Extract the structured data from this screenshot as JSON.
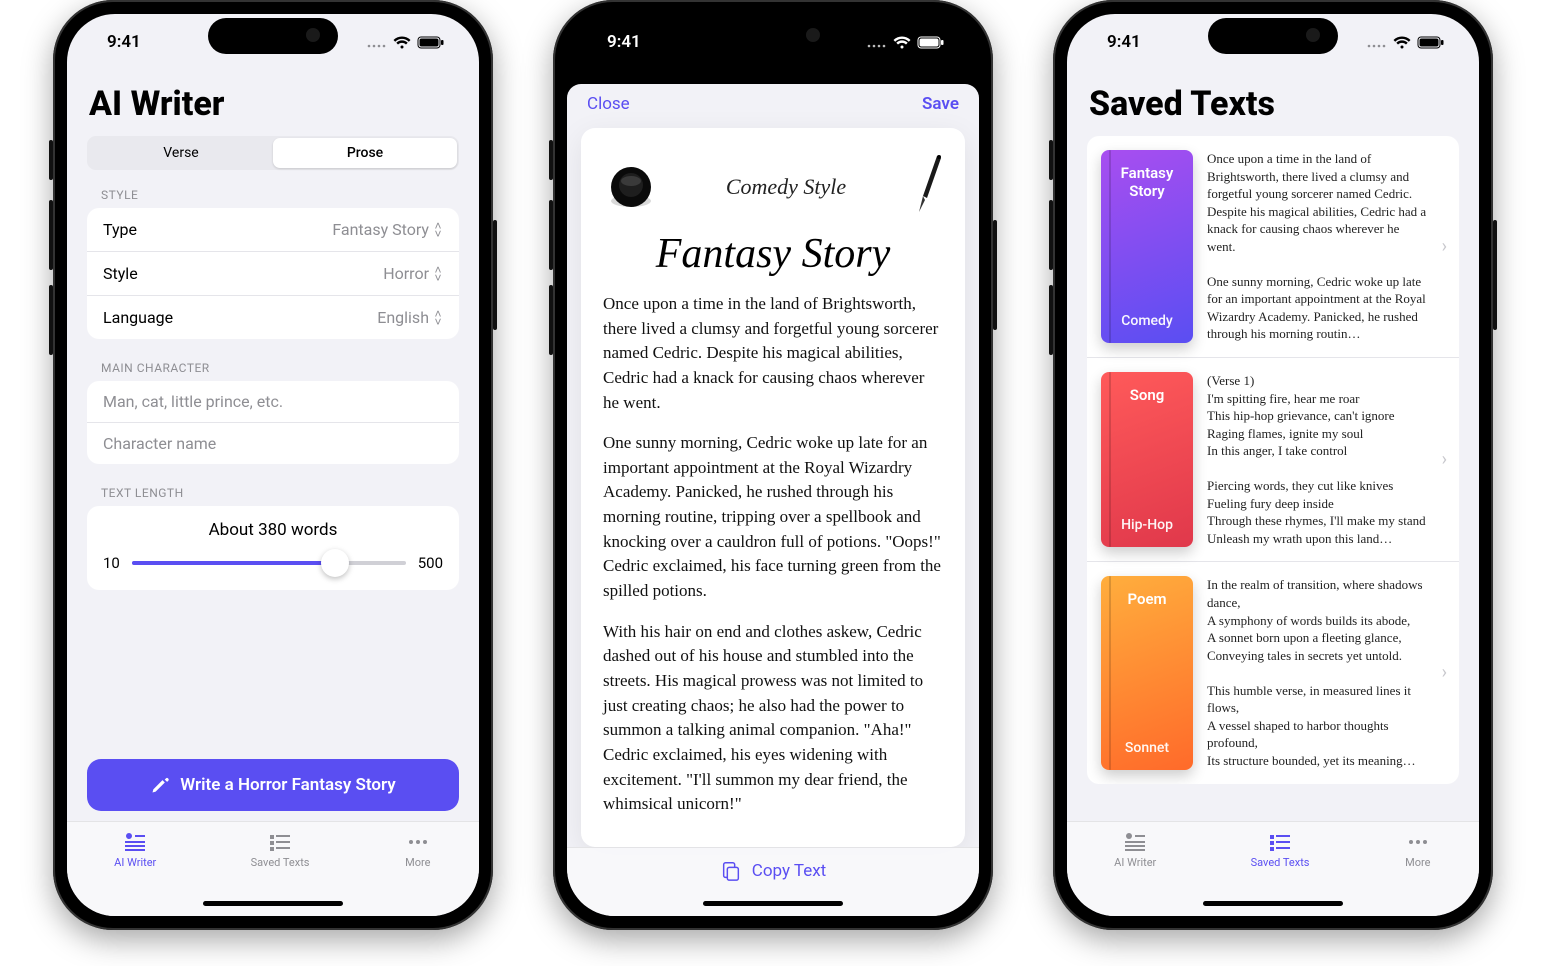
{
  "status": {
    "time": "9:41"
  },
  "phone1": {
    "title": "AI Writer",
    "segmented": {
      "options": [
        "Verse",
        "Prose"
      ],
      "active": 1
    },
    "style_section_label": "STYLE",
    "style_rows": [
      {
        "k": "Type",
        "v": "Fantasy Story"
      },
      {
        "k": "Style",
        "v": "Horror"
      },
      {
        "k": "Language",
        "v": "English"
      }
    ],
    "main_char_label": "MAIN CHARACTER",
    "main_char_placeholders": [
      "Man, cat, little prince, etc.",
      "Character name"
    ],
    "length_label": "TEXT LENGTH",
    "about_words": "About 380 words",
    "slider": {
      "min": "10",
      "max": "500",
      "pos_pct": 74
    },
    "cta": "Write a Horror Fantasy Story",
    "tabs": [
      "AI Writer",
      "Saved Texts",
      "More"
    ],
    "active_tab": 0
  },
  "phone2": {
    "close": "Close",
    "save": "Save",
    "style_label": "Comedy Style",
    "title": "Fantasy Story",
    "paragraphs": [
      "Once upon a time in the land of Brightsworth, there lived a clumsy and forgetful young sorcerer named Cedric. Despite his magical abilities, Cedric had a knack for causing chaos wherever he went.",
      "One sunny morning, Cedric woke up late for an important appointment at the Royal Wizardry Academy. Panicked, he rushed through his morning routine, tripping over a spellbook and knocking over a cauldron full of potions. \"Oops!\" Cedric exclaimed, his face turning green from the spilled potions.",
      "With his hair on end and clothes askew, Cedric dashed out of his house and stumbled into the streets. His magical prowess was not limited to just creating chaos; he also had the power to summon a talking animal companion. \"Aha!\" Cedric exclaimed, his eyes widening with excitement. \"I'll summon my dear friend, the whimsical unicorn!\""
    ],
    "copy": "Copy Text"
  },
  "phone3": {
    "title": "Saved Texts",
    "items": [
      {
        "tile_title": "Fantasy Story",
        "tile_sub": "Comedy",
        "grad": "grad-purple",
        "snippet": "Once upon a time in the land of Brightsworth, there lived a clumsy and forgetful young sorcerer named Cedric. Despite his magical abilities, Cedric had a knack for causing chaos wherever he went.\n\nOne sunny morning, Cedric woke up late for an important appointment at the Royal Wizardry Academy. Panicked, he rushed through his morning routin…"
      },
      {
        "tile_title": "Song",
        "tile_sub": "Hip-Hop",
        "grad": "grad-red",
        "snippet": "(Verse 1)\nI'm spitting fire, hear me roar\nThis hip-hop grievance, can't ignore\nRaging flames, ignite my soul\nIn this anger, I take control\n\nPiercing words, they cut like knives\nFueling fury deep inside\nThrough these rhymes, I'll make my stand\nUnleash my wrath upon this land…"
      },
      {
        "tile_title": "Poem",
        "tile_sub": "Sonnet",
        "grad": "grad-orange",
        "snippet": "In the realm of transition, where shadows dance,\nA symphony of words builds its abode,\nA sonnet born upon a fleeting glance,\nConveying tales in secrets yet untold.\n\nThis humble verse, in measured lines it flows,\nA vessel shaped to harbor thoughts profound,\nIts structure bounded, yet its meaning…"
      }
    ],
    "tabs": [
      "AI Writer",
      "Saved Texts",
      "More"
    ],
    "active_tab": 1
  }
}
